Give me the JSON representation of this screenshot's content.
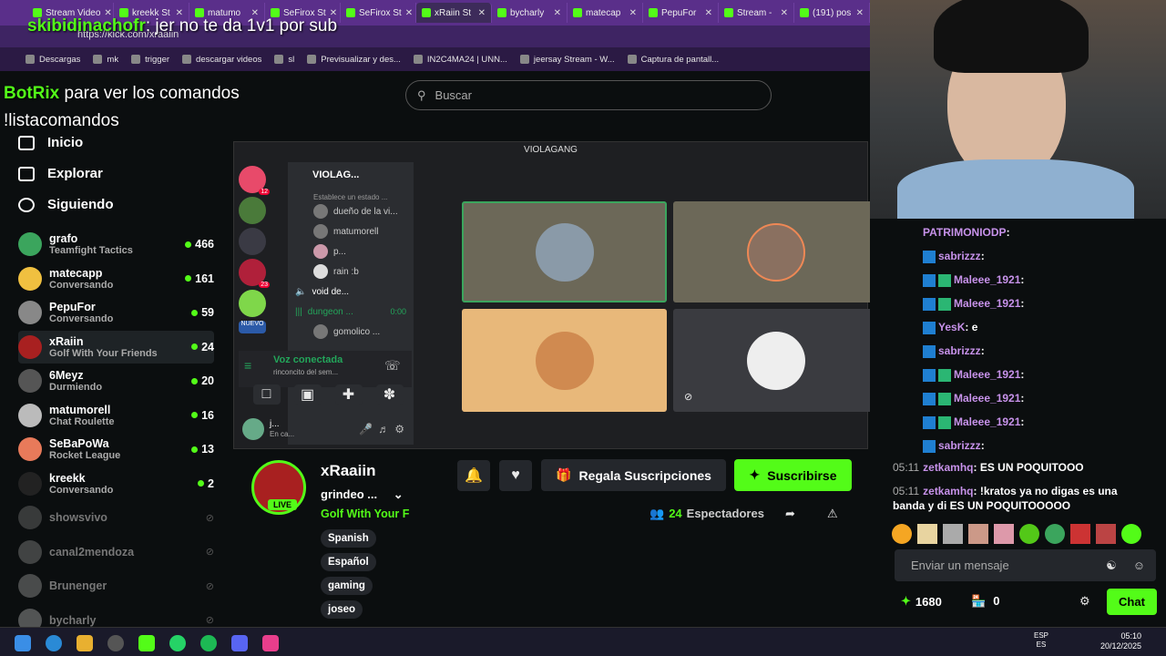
{
  "browser": {
    "tabs": [
      {
        "label": "Stream Video",
        "active": false
      },
      {
        "label": "kreekk St",
        "active": false
      },
      {
        "label": "matumo",
        "active": false
      },
      {
        "label": "SeFirox St",
        "active": false
      },
      {
        "label": "SeFirox St",
        "active": false
      },
      {
        "label": "xRaiin St",
        "active": true
      },
      {
        "label": "bycharly",
        "active": false
      },
      {
        "label": "matecap",
        "active": false
      },
      {
        "label": "PepuFor",
        "active": false
      },
      {
        "label": "Stream -",
        "active": false
      },
      {
        "label": "(191) pos",
        "active": false
      }
    ],
    "address": "https://kick.com/xraaiin",
    "bookmarks": [
      "Descargas",
      "mk",
      "trigger",
      "descargar videos",
      "sl",
      "Previsualizar y des...",
      "IN2C4MA24 | UNN...",
      "jeersay Stream - W...",
      "Captura de pantall..."
    ]
  },
  "overlay": {
    "top_user": "skibidinachofr",
    "top_text": ": jer no te da 1v1 por sub",
    "bot_name": "BotRix",
    "bot_text": " para ver los comandos",
    "bot_cmd": "!listacomandos"
  },
  "search": {
    "placeholder": "Buscar"
  },
  "nav": {
    "home": "Inicio",
    "explore": "Explorar",
    "following": "Siguiendo"
  },
  "channels": [
    {
      "name": "grafo",
      "category": "Teamfight Tactics",
      "viewers": "466",
      "live": true
    },
    {
      "name": "matecapp",
      "category": "Conversando",
      "viewers": "161",
      "live": true
    },
    {
      "name": "PepuFor",
      "category": "Conversando",
      "viewers": "59",
      "live": true
    },
    {
      "name": "xRaiin",
      "category": "Golf With Your Friends",
      "viewers": "24",
      "live": true,
      "selected": true
    },
    {
      "name": "6Meyz",
      "category": "Durmiendo",
      "viewers": "20",
      "live": true
    },
    {
      "name": "matumorell",
      "category": "Chat Roulette",
      "viewers": "16",
      "live": true
    },
    {
      "name": "SeBaPoWa",
      "category": "Rocket League",
      "viewers": "13",
      "live": true
    },
    {
      "name": "kreekk",
      "category": "Conversando",
      "viewers": "2",
      "live": true
    },
    {
      "name": "showsvivo",
      "category": "",
      "viewers": "",
      "live": false
    },
    {
      "name": "canal2mendoza",
      "category": "",
      "viewers": "",
      "live": false
    },
    {
      "name": "Brunenger",
      "category": "",
      "viewers": "",
      "live": false
    },
    {
      "name": "bycharly",
      "category": "",
      "viewers": "",
      "live": false
    }
  ],
  "discord": {
    "window_title": "VIOLAGANG",
    "server_name": "VIOLAG...",
    "status_prompt": "Establece un estado ...",
    "members": [
      "dueño de la vi...",
      "matumorell",
      "p...",
      "rain :b"
    ],
    "voice_channel": "void de...",
    "active_channel": "dungeon ...",
    "active_time": "0:00",
    "other_member": "gomolico ...",
    "new_badge": "NUEVO",
    "badge_counts": [
      "12",
      "23"
    ],
    "voice_status": "Voz conectada",
    "voice_sub": "rinconcito del sem...",
    "user_name": "j...",
    "user_status": "En ca..."
  },
  "stream": {
    "name": "xRaaiin",
    "title": "grindeo ...",
    "category": "Golf With Your F",
    "live": "LIVE",
    "tags": [
      "Spanish",
      "Español",
      "gaming",
      "joseo"
    ],
    "gift_button": "Regala Suscripciones",
    "subscribe_button": "Suscribirse",
    "viewers": "24",
    "viewers_label": "Espectadores"
  },
  "chat": {
    "messages": [
      {
        "user": "PATRIMONIODP",
        "text": ":",
        "ts": ""
      },
      {
        "user": "sabrizzz",
        "text": ":",
        "ts": ""
      },
      {
        "user": "Maleee_1921",
        "text": ":",
        "ts": ""
      },
      {
        "user": "Maleee_1921",
        "text": ":",
        "ts": ""
      },
      {
        "user": "YesK",
        "text": ": e",
        "ts": ""
      },
      {
        "user": "sabrizzz",
        "text": ":",
        "ts": ""
      },
      {
        "user": "Maleee_1921",
        "text": ":",
        "ts": ""
      },
      {
        "user": "Maleee_1921",
        "text": ":",
        "ts": ""
      },
      {
        "user": "Maleee_1921",
        "text": ":",
        "ts": ""
      },
      {
        "user": "sabrizzz",
        "text": ":",
        "ts": ""
      },
      {
        "user": "zetkamhq",
        "text": ": ES UN POQUITOOO",
        "ts": "05:11"
      },
      {
        "user": "zetkamhq",
        "text": ": !kratos ya no digas es una",
        "ts": "05:11"
      },
      {
        "user": "",
        "text": "banda y di ES UN POQUITOOOOO",
        "ts": ""
      }
    ],
    "input_placeholder": "Enviar un mensaje",
    "points": "1680",
    "store_count": "0",
    "chat_button": "Chat"
  },
  "taskbar": {
    "lang": "ESP",
    "lang2": "ES",
    "time": "05:10",
    "date": "20/12/2025"
  }
}
